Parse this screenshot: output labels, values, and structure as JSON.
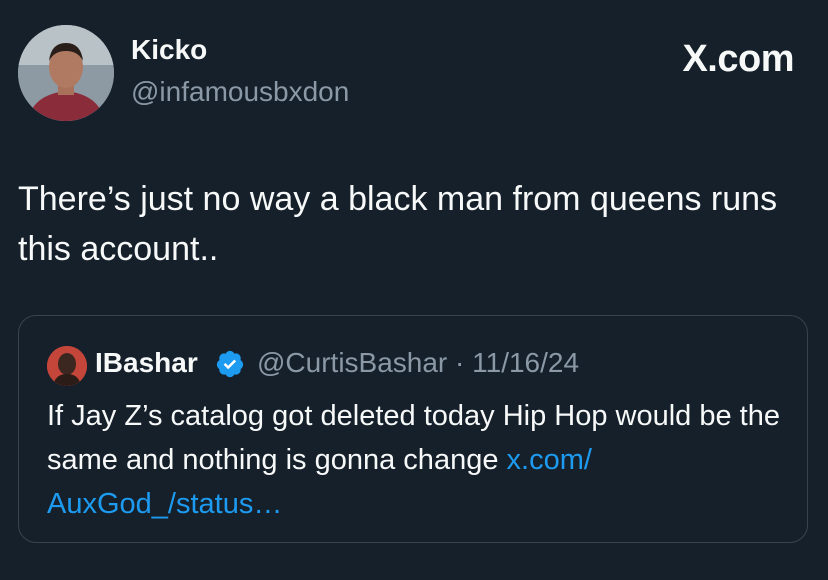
{
  "author": {
    "name": "Kicko",
    "handle": "@infamousbxdon"
  },
  "brand": "X.com",
  "tweet": {
    "text": "There’s just no way a black man from queens runs this account.."
  },
  "quoted": {
    "name": "IBashar",
    "handle_and_date": "@CurtisBashar · 11/16/24",
    "text": "If Jay Z’s catalog got deleted today Hip Hop would be the same and nothing is gonna change ",
    "link": "x.com/ AuxGod_/status…"
  },
  "colors": {
    "background": "#15202b",
    "link": "#1d9bf0",
    "verified": "#1d9bf0",
    "muted": "#8b98a5"
  },
  "icons": {
    "verified": "verified-badge-icon"
  }
}
